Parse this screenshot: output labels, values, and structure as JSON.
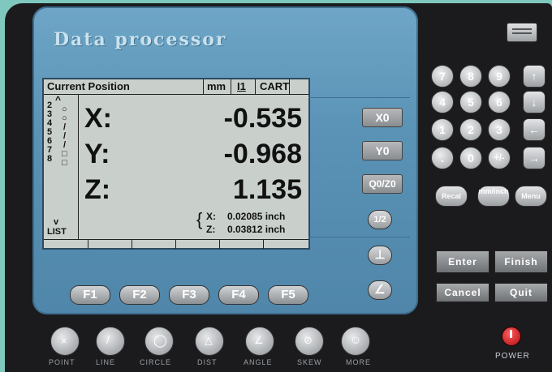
{
  "panel": {
    "title": "Data processor"
  },
  "lcd": {
    "header_title": "Current Position",
    "unit": "mm",
    "mode_icon": "I1",
    "coord_system": "CART",
    "side_numbers": [
      "2",
      "3",
      "4",
      "5",
      "6",
      "7",
      "8"
    ],
    "side_marks": [
      "○",
      "○",
      "/",
      "/",
      "/",
      "□",
      "□"
    ],
    "list_label": "LIST",
    "axes": [
      {
        "label": "X:",
        "value": "-0.535"
      },
      {
        "label": "Y:",
        "value": "-0.968"
      },
      {
        "label": "Z:",
        "value": "1.135"
      }
    ],
    "sub_x_label": "X:",
    "sub_x_value": "0.02085 inch",
    "sub_z_label": "Z:",
    "sub_z_value": "0.03812 inch"
  },
  "side_keys": {
    "x0": "X0",
    "y0": "Y0",
    "q0z0": "Q0/Z0",
    "half": "1/2"
  },
  "fkeys": [
    "F1",
    "F2",
    "F3",
    "F4",
    "F5"
  ],
  "bottom_keys": [
    "POINT",
    "LINE",
    "CIRCLE",
    "DIST",
    "ANGLE",
    "SKEW",
    "MORE"
  ],
  "numpad": {
    "row1": [
      "7",
      "8",
      "9"
    ],
    "row2": [
      "4",
      "5",
      "6"
    ],
    "row3": [
      "1",
      "2",
      "3"
    ],
    "row4": [
      ".",
      "0",
      "+/-"
    ],
    "recall": "Recal",
    "mm_inch": "mm/inch",
    "menu": "Menu"
  },
  "action_keys": {
    "enter": "Enter",
    "finish": "Finish",
    "cancel": "Cancel",
    "quit": "Quit"
  },
  "power_label": "POWER",
  "colors": {
    "panel_blue": "#5a93b6",
    "lcd_bg": "#c9d0cc",
    "power_red": "#c4141b"
  }
}
